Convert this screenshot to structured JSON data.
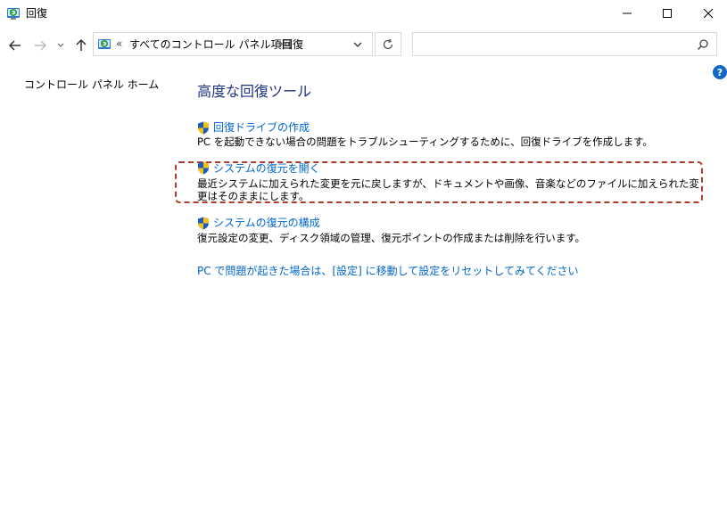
{
  "window": {
    "title": "回復",
    "icon": "recovery-icon"
  },
  "titlebar_buttons": {
    "minimize": "minimize-icon",
    "maximize": "maximize-icon",
    "close": "close-icon"
  },
  "nav": {
    "back": "back-arrow-icon",
    "forward": "forward-arrow-icon",
    "recent": "chevron-down-icon",
    "up": "up-arrow-icon"
  },
  "address": {
    "overflow": "«",
    "crumbs": [
      "すべてのコントロール パネル項目",
      "回復"
    ],
    "separator": "›"
  },
  "search": {
    "placeholder": ""
  },
  "sidebar": {
    "home_label": "コントロール パネル ホーム"
  },
  "main": {
    "section_title": "高度な回復ツール",
    "items": [
      {
        "link": "回復ドライブの作成",
        "description": "PC を起動できない場合の問題をトラブルシューティングするために、回復ドライブを作成します。"
      },
      {
        "link": "システムの復元を開く",
        "description": "最近システムに加えられた変更を元に戻しますが、ドキュメントや画像、音楽などのファイルに加えられた変更はそのままにします。"
      },
      {
        "link": "システムの復元の構成",
        "description": "復元設定の変更、ディスク領域の管理、復元ポイントの作成または削除を行います。"
      }
    ],
    "reset_link": "PC で問題が起きた場合は、[設定] に移動して設定をリセットしてみてください"
  },
  "colors": {
    "link": "#0066cc",
    "title": "#1e3287",
    "highlight_border": "#b13a2a",
    "help": "#1166c6"
  }
}
